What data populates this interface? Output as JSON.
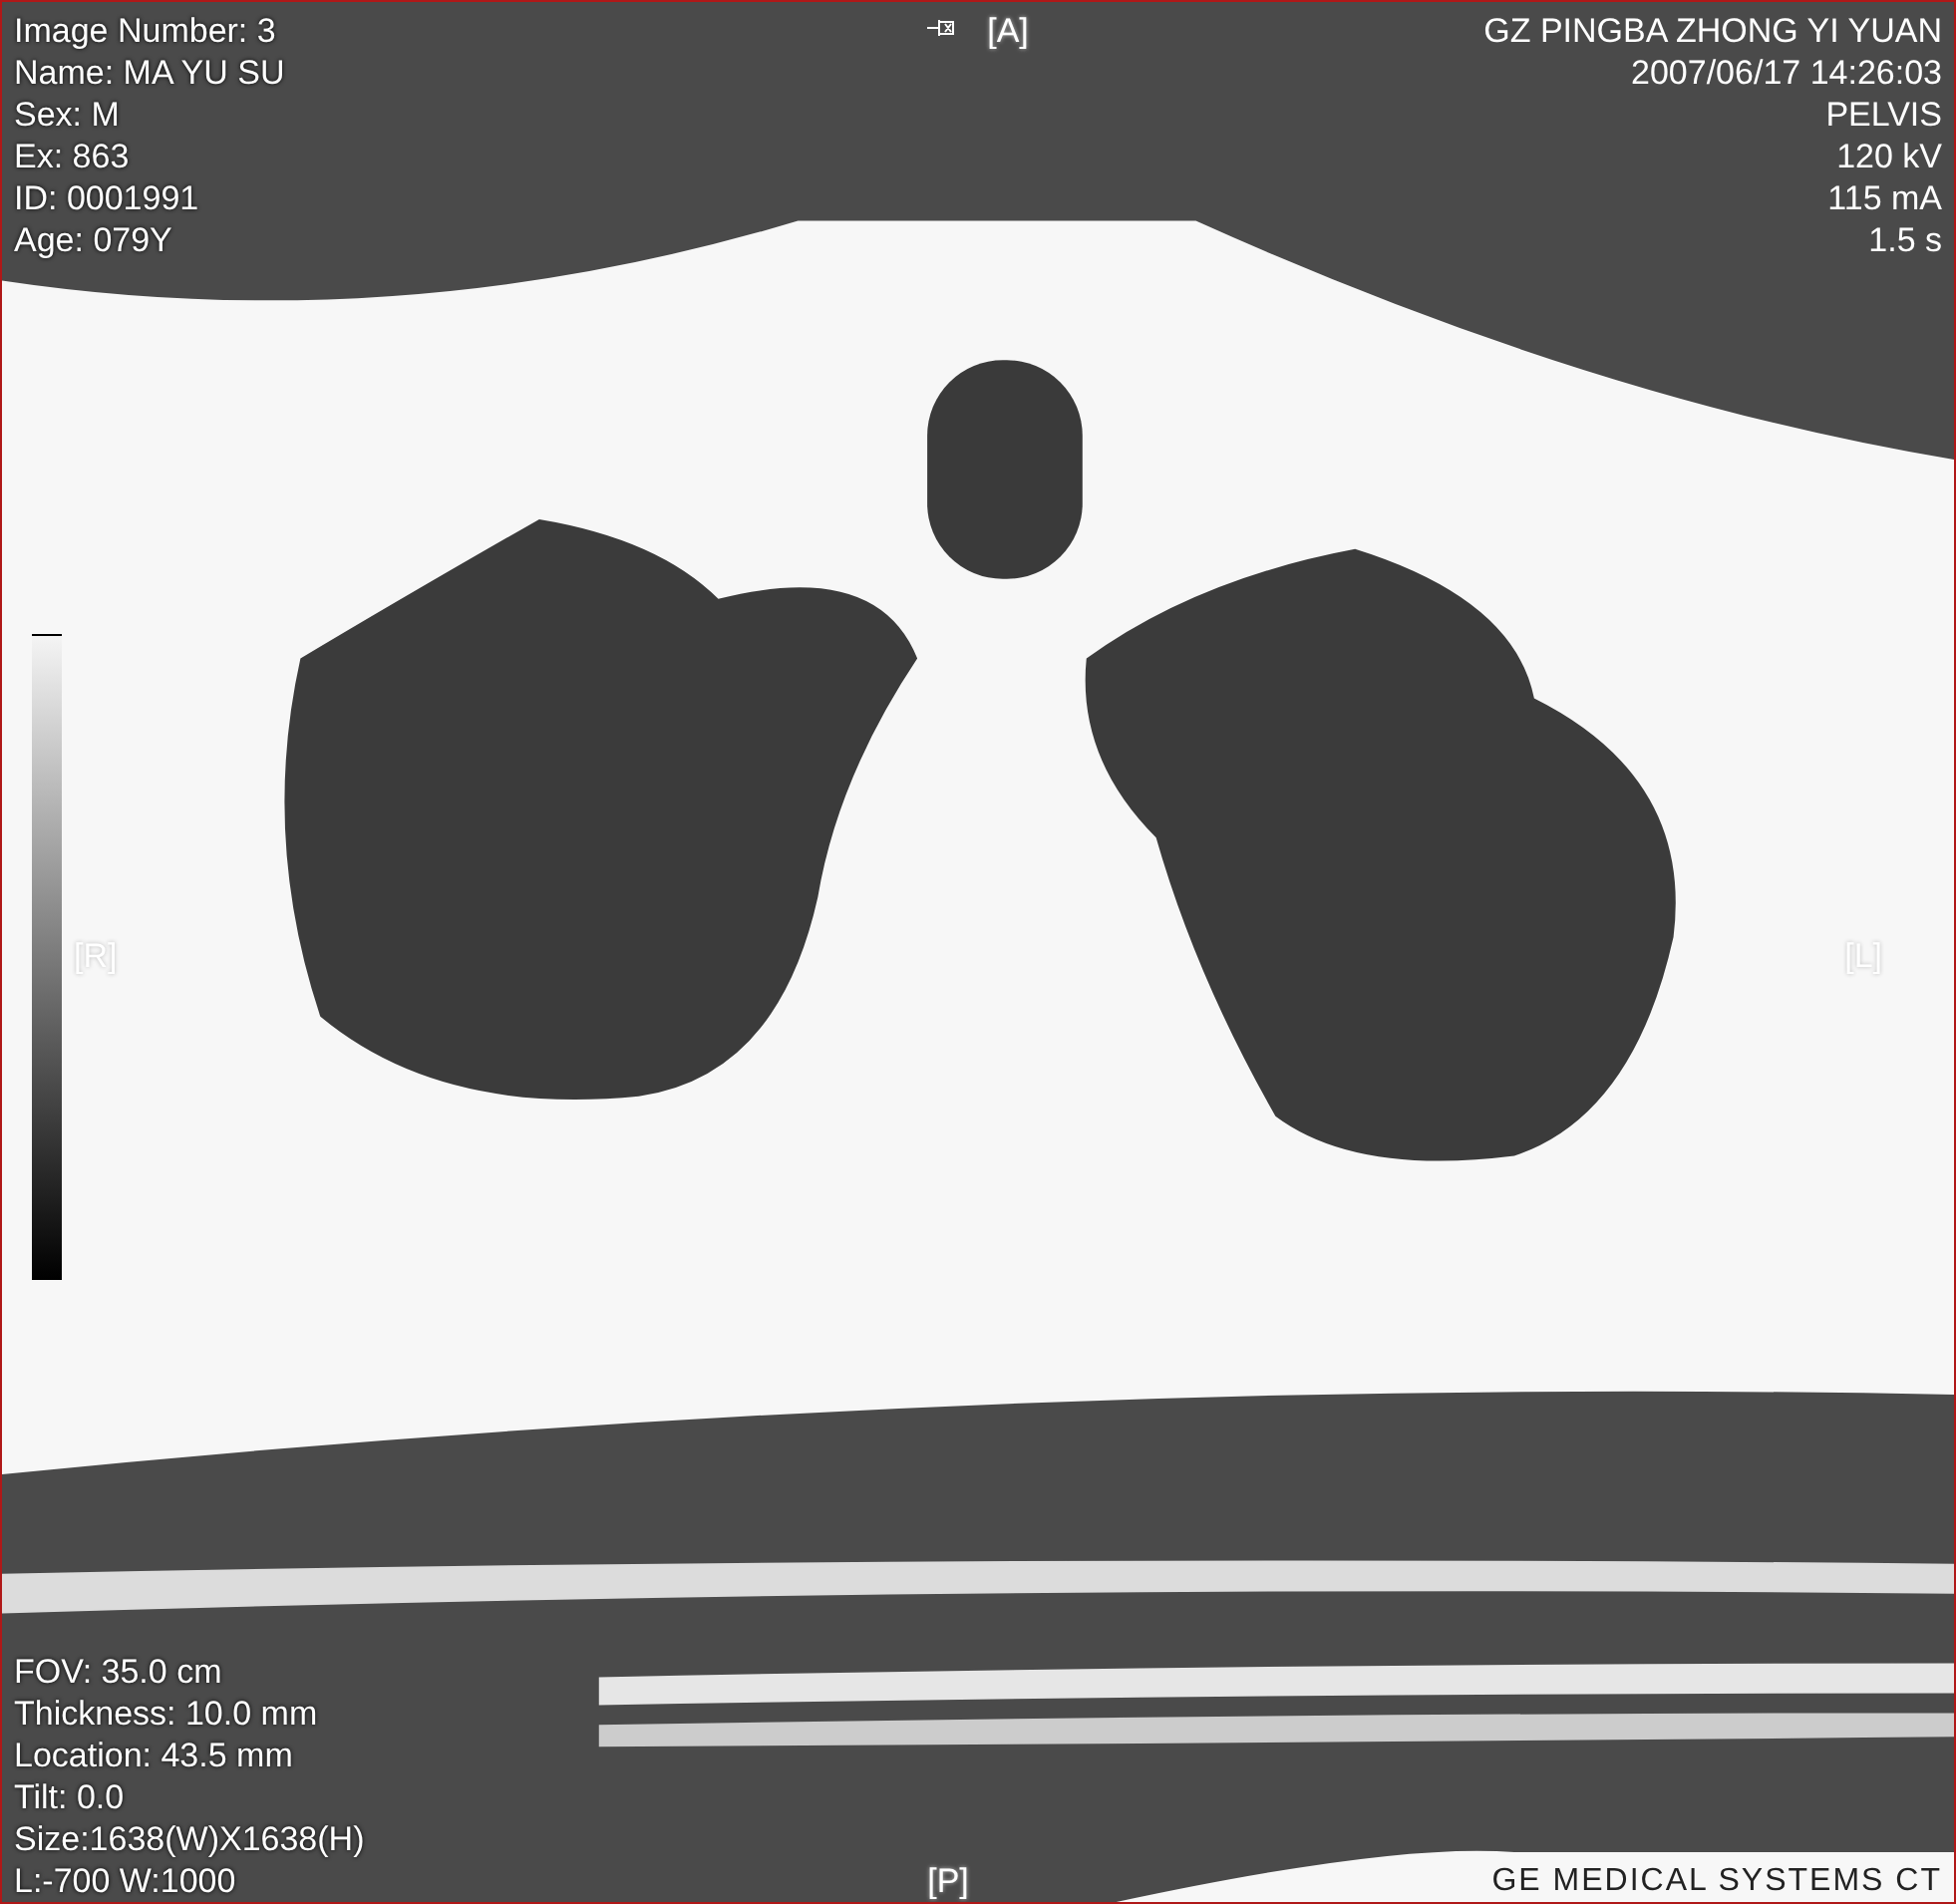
{
  "viewer": {
    "top_left": [
      "Image Number: 3",
      "Name: MA YU SU",
      "Sex: M",
      "Ex: 863",
      "ID: 0001991",
      "Age: 079Y"
    ],
    "top_marker": "[A]",
    "top_right": [
      "GZ PINGBA ZHONG YI YUAN",
      "2007/06/17 14:26:03",
      "PELVIS",
      "120 kV",
      "115 mA",
      "1.5 s"
    ],
    "left_marker": "[R]",
    "right_marker": "[L]",
    "bottom_left": [
      "FOV: 35.0 cm",
      "Thickness: 10.0 mm",
      "Location: 43.5 mm",
      "Tilt: 0.0",
      "Size:1638(W)X1638(H)",
      "L:-700  W:1000"
    ],
    "bottom_marker": "[P]",
    "bottom_right": "GE MEDICAL SYSTEMS CT"
  }
}
